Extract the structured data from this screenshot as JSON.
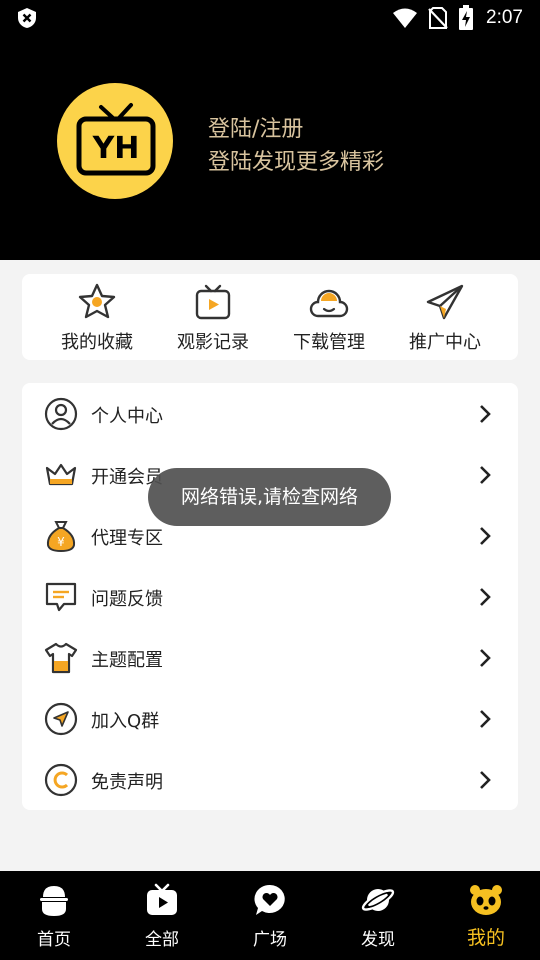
{
  "status_bar": {
    "time": "2:07",
    "icons": [
      "shield-x-icon",
      "wifi-icon",
      "no-sim-icon",
      "battery-charging-icon"
    ]
  },
  "header": {
    "logo_text": "YH",
    "login_title": "登陆/注册",
    "login_subtitle": "登陆发现更多精彩"
  },
  "quick_actions": [
    {
      "label": "我的收藏",
      "icon": "star-icon"
    },
    {
      "label": "观影记录",
      "icon": "tv-play-icon"
    },
    {
      "label": "下载管理",
      "icon": "cloud-icon"
    },
    {
      "label": "推广中心",
      "icon": "paper-plane-icon"
    }
  ],
  "menu": [
    {
      "label": "个人中心",
      "icon": "user-icon"
    },
    {
      "label": "开通会员",
      "icon": "crown-icon"
    },
    {
      "label": "代理专区",
      "icon": "money-bag-icon"
    },
    {
      "label": "问题反馈",
      "icon": "feedback-icon"
    },
    {
      "label": "主题配置",
      "icon": "shirt-icon"
    },
    {
      "label": "加入Q群",
      "icon": "navigation-icon"
    },
    {
      "label": "免责声明",
      "icon": "copyright-icon"
    }
  ],
  "toast": {
    "message": "网络错误,请检查网络"
  },
  "bottom_nav": [
    {
      "label": "首页",
      "icon": "home-icon",
      "active": false
    },
    {
      "label": "全部",
      "icon": "tv-icon",
      "active": false
    },
    {
      "label": "广场",
      "icon": "chat-heart-icon",
      "active": false
    },
    {
      "label": "发现",
      "icon": "planet-icon",
      "active": false
    },
    {
      "label": "我的",
      "icon": "panda-icon",
      "active": true
    }
  ],
  "colors": {
    "accent": "#f5c021",
    "logo_bg": "#fcd34a",
    "header_bg": "#000000",
    "login_text": "#d8c39e",
    "icon_orange": "#f5a623"
  }
}
